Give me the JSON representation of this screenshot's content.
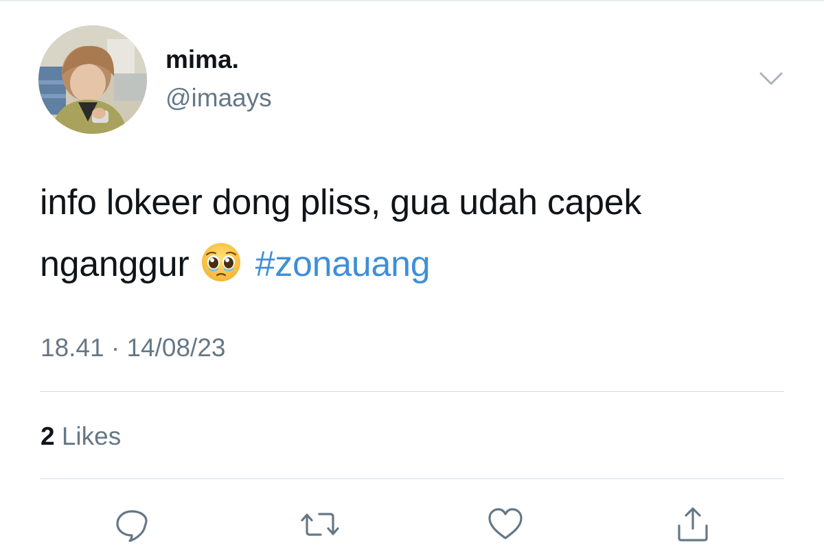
{
  "tweet": {
    "display_name": "mima.",
    "handle": "@imaays",
    "text_before": "info lokeer dong pliss, gua udah capek nganggur",
    "emoji_icon": "pleading-face-emoji",
    "hashtag": "#zonauang",
    "timestamp": "18.41 · 14/08/23",
    "likes_count": "2",
    "likes_label": " Likes"
  },
  "actions": {
    "reply_icon": "reply-icon",
    "retweet_icon": "retweet-icon",
    "like_icon": "heart-icon",
    "share_icon": "share-icon",
    "more_icon": "chevron-down-icon"
  },
  "colors": {
    "text": "#0f1419",
    "secondary": "#657786",
    "hashtag": "#3e8fd8",
    "divider": "#d5dce2"
  }
}
